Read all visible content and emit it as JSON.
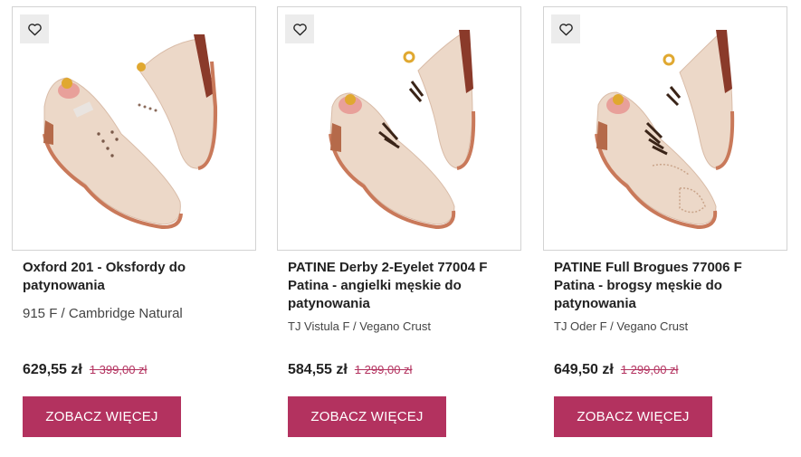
{
  "products": [
    {
      "title": "Oxford 201 - Oksfordy do patynowania",
      "variant": "915 F / Cambridge Natural",
      "price": "629,55 zł",
      "old_price": "1 399,00 zł",
      "button": "ZOBACZ WIĘCEJ",
      "image_icon": "shoe-oxford-wholecut-icon"
    },
    {
      "title": "PATINE Derby 2-Eyelet 77004 F Patina - angielki męskie do patynowania",
      "variant": "TJ Vistula F / Vegano Crust",
      "price": "584,55 zł",
      "old_price": "1 299,00 zł",
      "button": "ZOBACZ WIĘCEJ",
      "image_icon": "shoe-derby-icon"
    },
    {
      "title": "PATINE Full Brogues 77006 F Patina - brogsy męskie do patynowania",
      "variant": "TJ Oder F / Vegano Crust",
      "price": "649,50 zł",
      "old_price": "1 299,00 zł",
      "button": "ZOBACZ WIĘCEJ",
      "image_icon": "shoe-brogue-icon"
    }
  ],
  "colors": {
    "accent": "#b3325f",
    "shoe_leather": "#ecd8c8",
    "sole": "#c9795a",
    "card_border": "#d3d3d3",
    "fav_bg": "#ececec"
  }
}
